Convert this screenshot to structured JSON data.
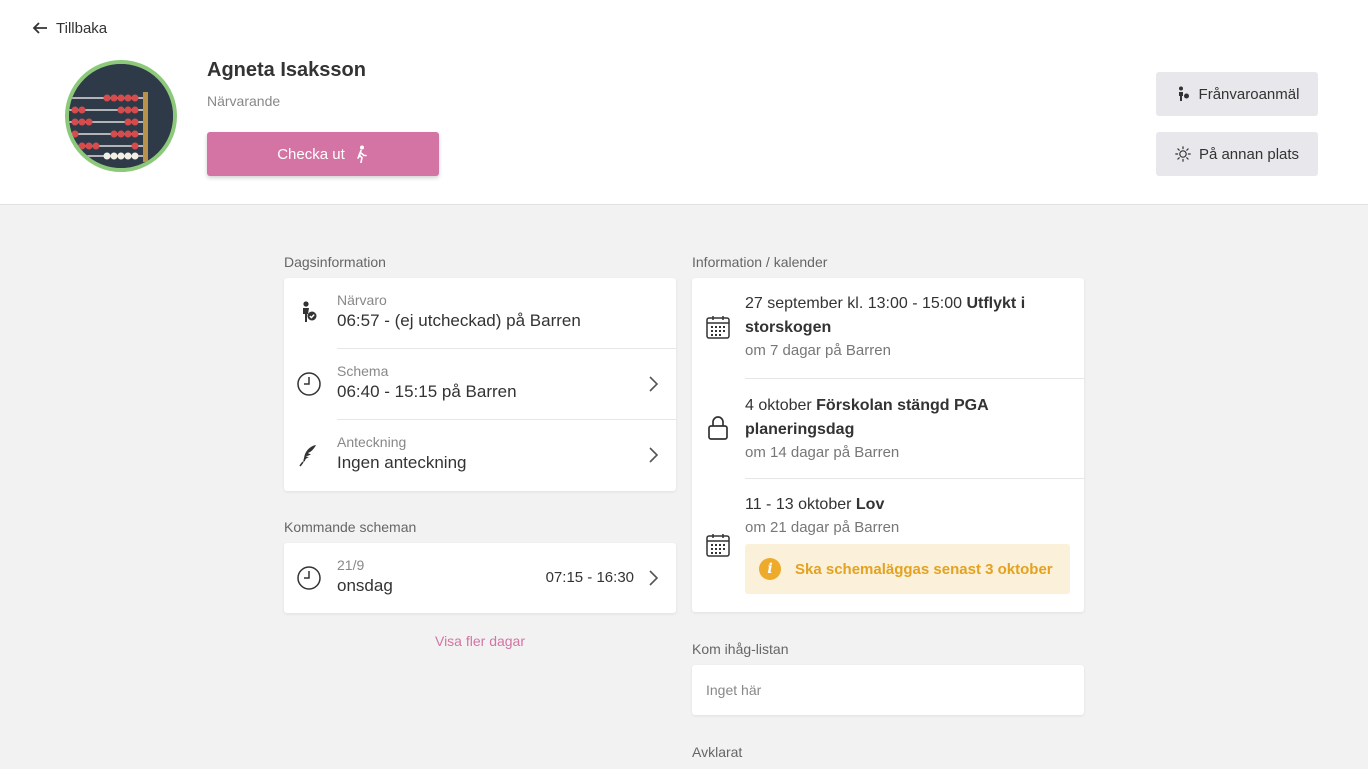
{
  "header": {
    "back_label": "Tillbaka",
    "name": "Agneta Isaksson",
    "status": "Närvarande",
    "checkout_label": "Checka ut",
    "absence_label": "Frånvaroanmäl",
    "elsewhere_label": "På annan plats"
  },
  "colors": {
    "accent": "#d374a4",
    "avatar_ring": "#8cc97a",
    "notice_bg": "#fbf0d9",
    "notice_text": "#e3a220"
  },
  "day_info": {
    "title": "Dagsinformation",
    "rows": [
      {
        "icon": "person-check-icon",
        "label": "Närvaro",
        "value": "06:57 - (ej utcheckad) på Barren"
      },
      {
        "icon": "clock-icon",
        "label": "Schema",
        "value": "06:40 - 15:15 på Barren"
      },
      {
        "icon": "feather-icon",
        "label": "Anteckning",
        "value": "Ingen anteckning"
      }
    ]
  },
  "upcoming": {
    "title": "Kommande scheman",
    "rows": [
      {
        "icon": "clock-icon",
        "date": "21/9",
        "day": "onsdag",
        "time": "07:15 - 16:30"
      }
    ],
    "more_label": "Visa fler dagar"
  },
  "calendar": {
    "title": "Information / kalender",
    "events": [
      {
        "icon": "calendar-icon",
        "prefix": "27 september kl. 13:00 - 15:00 ",
        "bold": "Utflykt i storskogen",
        "sub": "om 7 dagar på Barren"
      },
      {
        "icon": "lock-icon",
        "prefix": "4 oktober ",
        "bold": "Förskolan stängd PGA planeringsdag",
        "sub": "om 14 dagar på Barren"
      },
      {
        "icon": "calendar-icon",
        "prefix": "11 - 13 oktober ",
        "bold": "Lov",
        "sub": "om 21 dagar på Barren",
        "notice": "Ska schemaläggas senast 3 oktober"
      }
    ]
  },
  "reminder": {
    "title": "Kom ihåg-listan",
    "placeholder": "Inget här"
  },
  "done": {
    "title": "Avklarat"
  }
}
